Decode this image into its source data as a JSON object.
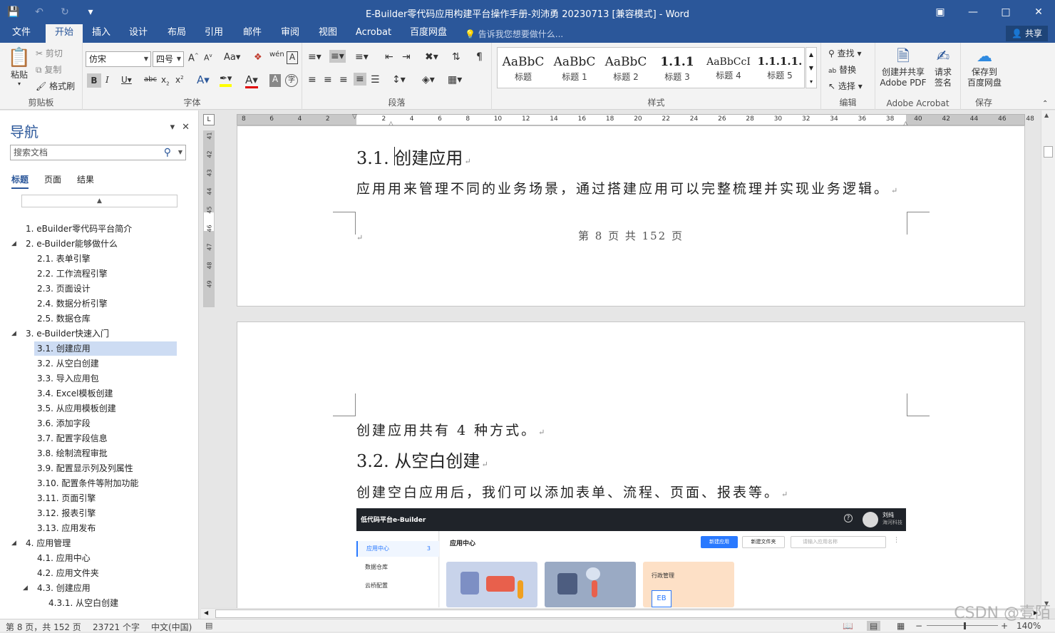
{
  "window": {
    "title": "E-Builder零代码应用构建平台操作手册-刘沛勇 20230713 [兼容模式] - Word"
  },
  "ribbon_tabs": [
    "文件",
    "开始",
    "插入",
    "设计",
    "布局",
    "引用",
    "邮件",
    "审阅",
    "视图",
    "Acrobat",
    "百度网盘"
  ],
  "tellme": "告诉我您想要做什么...",
  "share": "共享",
  "clipboard": {
    "paste": "粘贴",
    "cut": "剪切",
    "copy": "复制",
    "format_painter": "格式刷",
    "group": "剪贴板"
  },
  "font": {
    "name": "仿宋",
    "size": "四号",
    "group": "字体"
  },
  "paragraph": {
    "group": "段落"
  },
  "styles": {
    "group": "样式",
    "items": [
      {
        "sample": "AaBbC",
        "name": "标题"
      },
      {
        "sample": "AaBbC",
        "name": "标题 1"
      },
      {
        "sample": "AaBbC",
        "name": "标题 2"
      },
      {
        "sample": "1.1.1",
        "name": "标题 3"
      },
      {
        "sample": "AaBbCcI",
        "name": "标题 4"
      },
      {
        "sample": "1.1.1.1.",
        "name": "标题 5"
      }
    ]
  },
  "editing": {
    "find": "查找",
    "replace": "替换",
    "select": "选择",
    "group": "编辑"
  },
  "acrobat": {
    "create_pdf_line1": "创建并共享",
    "create_pdf_line2": "Adobe PDF",
    "sign_line1": "请求",
    "sign_line2": "签名",
    "group": "Adobe Acrobat"
  },
  "save_group": {
    "btn_line1": "保存到",
    "btn_line2": "百度网盘",
    "group": "保存"
  },
  "nav": {
    "title": "导航",
    "search_placeholder": "搜索文档",
    "tabs": [
      "标题",
      "页面",
      "结果"
    ],
    "items": [
      {
        "label": "1. eBuilder零代码平台简介",
        "level": 1,
        "expand": ""
      },
      {
        "label": "2. e-Builder能够做什么",
        "level": 1,
        "expand": "◢"
      },
      {
        "label": "2.1. 表单引擎",
        "level": 2,
        "expand": ""
      },
      {
        "label": "2.2. 工作流程引擎",
        "level": 2,
        "expand": ""
      },
      {
        "label": "2.3. 页面设计",
        "level": 2,
        "expand": ""
      },
      {
        "label": "2.4. 数据分析引擎",
        "level": 2,
        "expand": ""
      },
      {
        "label": "2.5. 数据仓库",
        "level": 2,
        "expand": ""
      },
      {
        "label": "3. e-Builder快速入门",
        "level": 1,
        "expand": "◢"
      },
      {
        "label": "3.1. 创建应用",
        "level": 2,
        "expand": "",
        "selected": true
      },
      {
        "label": "3.2. 从空白创建",
        "level": 2,
        "expand": ""
      },
      {
        "label": "3.3. 导入应用包",
        "level": 2,
        "expand": ""
      },
      {
        "label": "3.4. Excel模板创建",
        "level": 2,
        "expand": ""
      },
      {
        "label": "3.5. 从应用模板创建",
        "level": 2,
        "expand": ""
      },
      {
        "label": "3.6. 添加字段",
        "level": 2,
        "expand": ""
      },
      {
        "label": "3.7. 配置字段信息",
        "level": 2,
        "expand": ""
      },
      {
        "label": "3.8. 绘制流程审批",
        "level": 2,
        "expand": ""
      },
      {
        "label": "3.9. 配置显示列及列属性",
        "level": 2,
        "expand": ""
      },
      {
        "label": "3.10. 配置条件等附加功能",
        "level": 2,
        "expand": ""
      },
      {
        "label": "3.11. 页面引擎",
        "level": 2,
        "expand": ""
      },
      {
        "label": "3.12. 报表引擎",
        "level": 2,
        "expand": ""
      },
      {
        "label": "3.13. 应用发布",
        "level": 2,
        "expand": ""
      },
      {
        "label": "4. 应用管理",
        "level": 1,
        "expand": "◢"
      },
      {
        "label": "4.1. 应用中心",
        "level": 2,
        "expand": ""
      },
      {
        "label": "4.2. 应用文件夹",
        "level": 2,
        "expand": ""
      },
      {
        "label": "4.3. 创建应用",
        "level": 2,
        "expand": "◢"
      },
      {
        "label": "4.3.1. 从空白创建",
        "level": 3,
        "expand": ""
      }
    ]
  },
  "ruler": {
    "h_numbers": [
      "8",
      "6",
      "4",
      "2",
      "",
      "2",
      "4",
      "6",
      "8",
      "10",
      "12",
      "14",
      "16",
      "18",
      "20",
      "22",
      "24",
      "26",
      "28",
      "30",
      "32",
      "34",
      "36",
      "38",
      "40",
      "42",
      "44",
      "46",
      "48"
    ],
    "v_numbers": [
      "41",
      "42",
      "43",
      "44",
      "45",
      "46",
      "47",
      "48",
      "49"
    ]
  },
  "doc": {
    "heading_31": "3.1. 创建应用",
    "para_31": "应用用来管理不同的业务场景，通过搭建应用可以完整梳理并实现业务逻辑。",
    "footer": "第 8 页 共 152 页",
    "para_ways": "创建应用共有 4 种方式。",
    "heading_32": "3.2. 从空白创建",
    "para_32": "创建空白应用后，我们可以添加表单、流程、页面、报表等。"
  },
  "screenshot": {
    "logo": "低代码平台e-Builder",
    "user_name": "刘纯",
    "user_org": "海河科技",
    "side_items": [
      "应用中心",
      "数据仓库",
      "云桥配置"
    ],
    "side_count": "3",
    "main_title": "应用中心",
    "btn_new_app": "新建应用",
    "btn_new_folder": "新建文件夹",
    "search_placeholder": "请输入应用名称",
    "card3_title": "行政管理",
    "card3_icon": "EB"
  },
  "status": {
    "page": "第 8 页，共 152 页",
    "words": "23721 个字",
    "lang": "中文(中国)",
    "zoom": "140%"
  },
  "watermark": "CSDN @壹陌",
  "colors": {
    "word_blue": "#2b579a",
    "accent": "#2979ff"
  }
}
